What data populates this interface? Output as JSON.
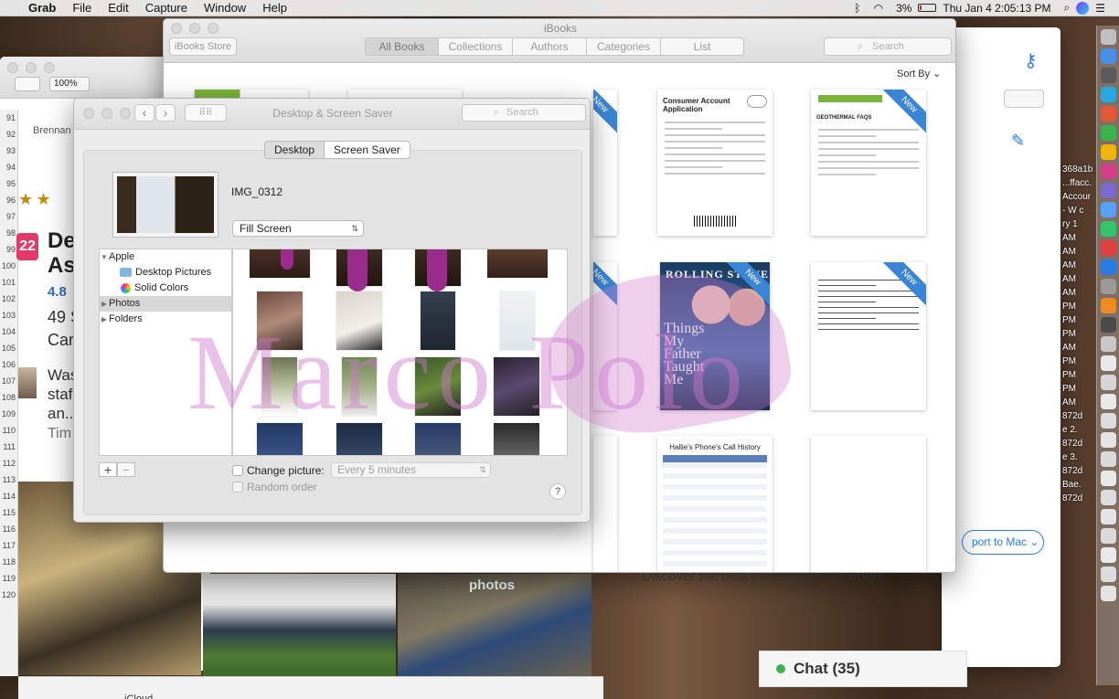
{
  "menubar": {
    "app": "Grab",
    "items": [
      "File",
      "Edit",
      "Capture",
      "Window",
      "Help"
    ],
    "battery": "3%",
    "clock": "Thu Jan 4  2:05:13 PM"
  },
  "bg_left": {
    "zoom": "100%",
    "author": "Brennan S",
    "title": "De\nAs",
    "badge": "22",
    "rating": "4.8",
    "stat": "49 S",
    "stat2": "Care",
    "snippet": "Was\nstaf\nan...",
    "attribution": "Tim",
    "row_numbers": [
      "91",
      "92",
      "93",
      "94",
      "95",
      "96",
      "97",
      "98",
      "99",
      "100",
      "101",
      "102",
      "103",
      "104",
      "105",
      "106",
      "107",
      "108",
      "109",
      "110",
      "111",
      "112",
      "113",
      "114",
      "115",
      "116",
      "117",
      "118",
      "119",
      "120"
    ],
    "photos_label": "photos",
    "icloud": "iCloud"
  },
  "bg_right": {
    "discover": "Discover the best places and see where",
    "chat": "Chat (35)",
    "export": "port to Mac",
    "desk_labels": [
      "368a1b",
      "...ffacc.",
      "Accour",
      "- W c",
      "ry 1",
      "AM",
      "AM",
      "AM",
      "AM",
      "AM",
      "PM",
      "PM",
      "PM",
      "AM",
      "PM",
      "PM",
      "PM",
      "AM",
      "872d",
      "e 2.",
      "872d",
      "e 3.",
      "872d",
      "Bae.",
      "872d"
    ]
  },
  "ibooks": {
    "title": "iBooks",
    "store": "iBooks Store",
    "tabs": [
      "All Books",
      "Collections",
      "Authors",
      "Categories",
      "List"
    ],
    "selected_tab": "All Books",
    "search_placeholder": "Search",
    "sort": "Sort By",
    "badge": "New",
    "books": {
      "consumer": "Consumer Account Application",
      "geo": "GEOTHERMAL FAQS",
      "rolling": {
        "masthead": "ROLLING STONE",
        "headline": "Things My Father Taught Me"
      },
      "handwritten": "Handwritten note",
      "hallie": "Hallie's Phone's Call History"
    }
  },
  "prefs": {
    "title": "Desktop & Screen Saver",
    "search_placeholder": "Search",
    "tabs": [
      "Desktop",
      "Screen Saver"
    ],
    "selected_tab": "Desktop",
    "image_name": "IMG_0312",
    "fill_mode": "Fill Screen",
    "sources": [
      {
        "label": "Apple",
        "level": 0,
        "expanded": true
      },
      {
        "label": "Desktop Pictures",
        "level": 1
      },
      {
        "label": "Solid Colors",
        "level": 1
      },
      {
        "label": "Photos",
        "level": 0,
        "selected": true
      },
      {
        "label": "Folders",
        "level": 0
      }
    ],
    "change_picture": "Change picture:",
    "interval": "Every 5 minutes",
    "random_order": "Random order",
    "help": "?"
  },
  "watermark": "Marco Polo",
  "colors": {
    "accent": "#3b86d4",
    "watermark": "#ce78cc",
    "chat_dot": "#3bb34a"
  }
}
